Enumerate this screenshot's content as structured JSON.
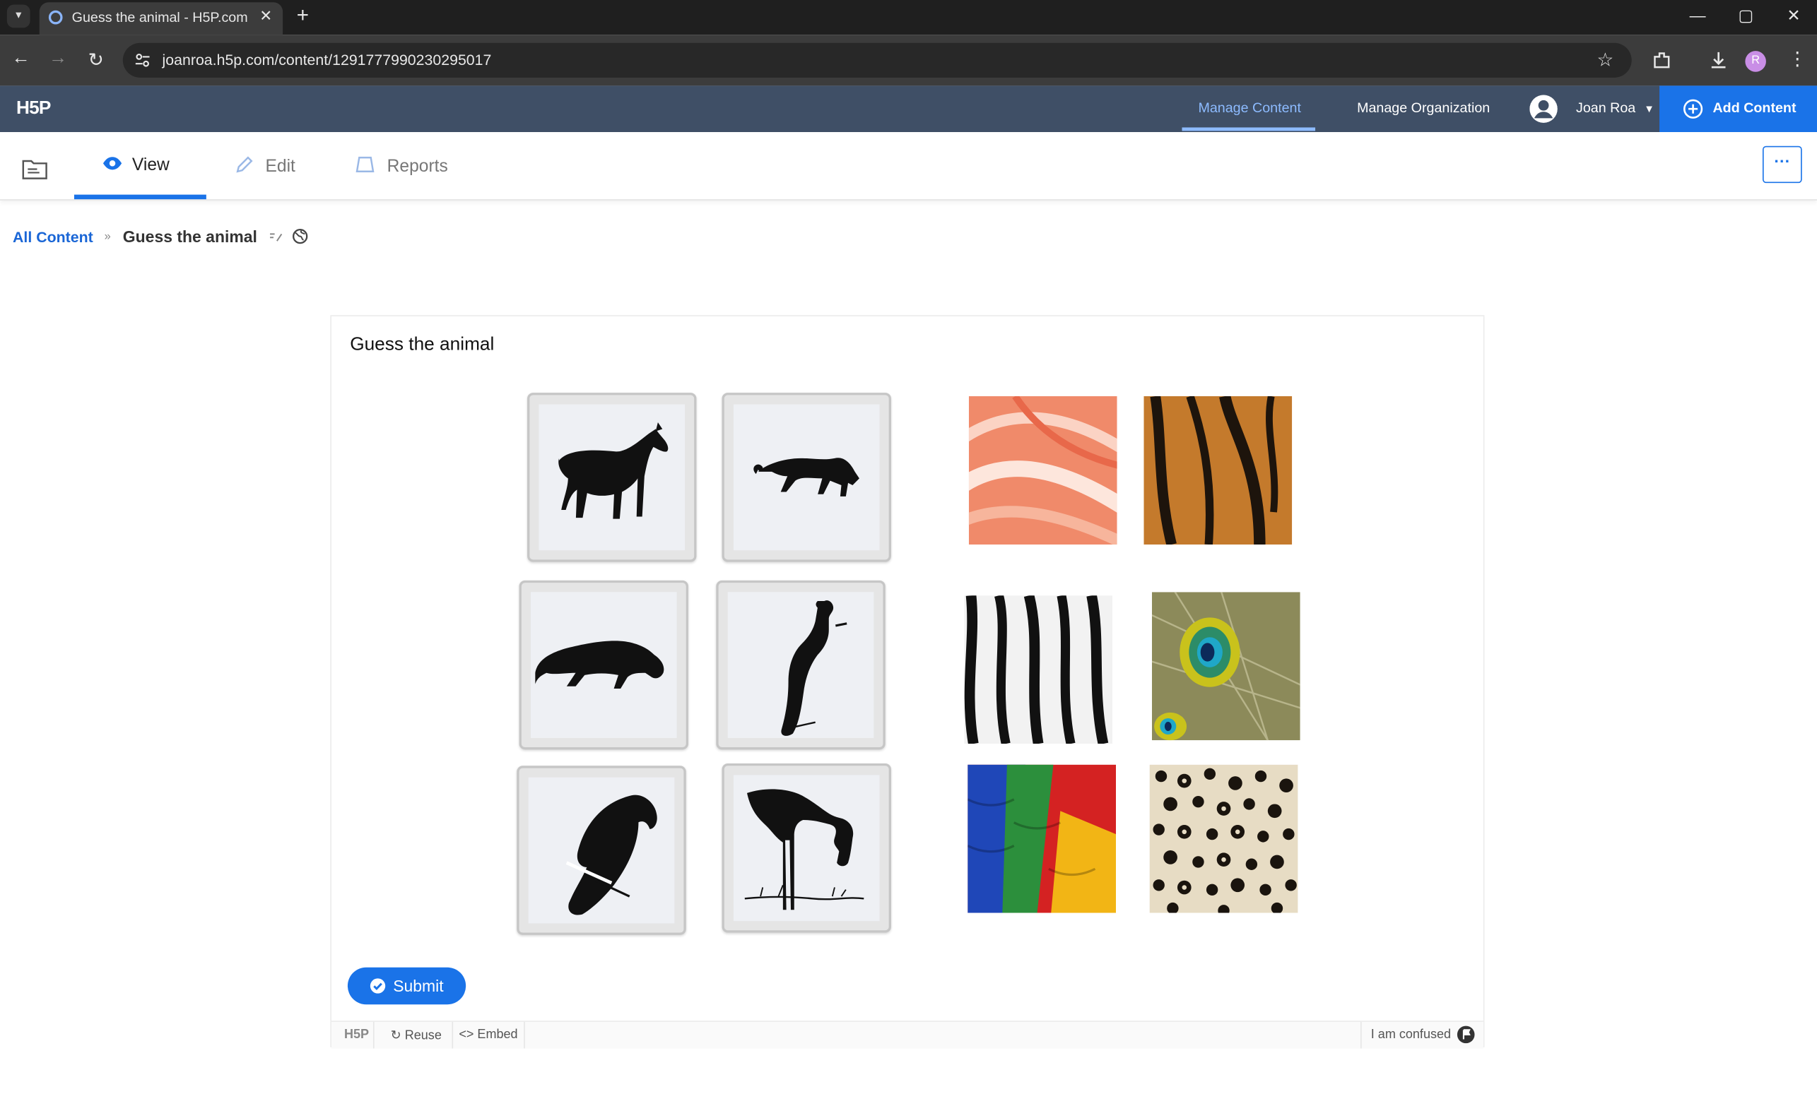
{
  "browser": {
    "tab_title": "Guess the animal - H5P.com",
    "url": "joanroa.h5p.com/content/1291777990230295017",
    "profile_initial": "R"
  },
  "header": {
    "logo": "H5P",
    "nav": [
      "Manage Content",
      "Manage Organization"
    ],
    "user_name": "Joan Roa",
    "add_content": "Add Content"
  },
  "view_tabs": [
    "View",
    "Edit",
    "Reports"
  ],
  "breadcrumb": {
    "root": "All Content",
    "separator": "»",
    "current": "Guess the animal"
  },
  "content": {
    "title": "Guess the animal",
    "silhouettes": [
      "horse",
      "panther",
      "tiger",
      "peacock",
      "parrot",
      "flamingo"
    ],
    "textures": [
      "flamingo-feathers",
      "tiger-stripes",
      "zebra-stripes",
      "peacock-feather",
      "macaw-feathers",
      "leopard-spots"
    ],
    "submit_label": "Submit"
  },
  "footer": {
    "logo": "H5P",
    "reuse": "Reuse",
    "embed": "Embed",
    "confused": "I am confused"
  },
  "colors": {
    "header_bg": "#3f4f66",
    "accent": "#1a73e8",
    "active_nav": "#8dbbff"
  }
}
